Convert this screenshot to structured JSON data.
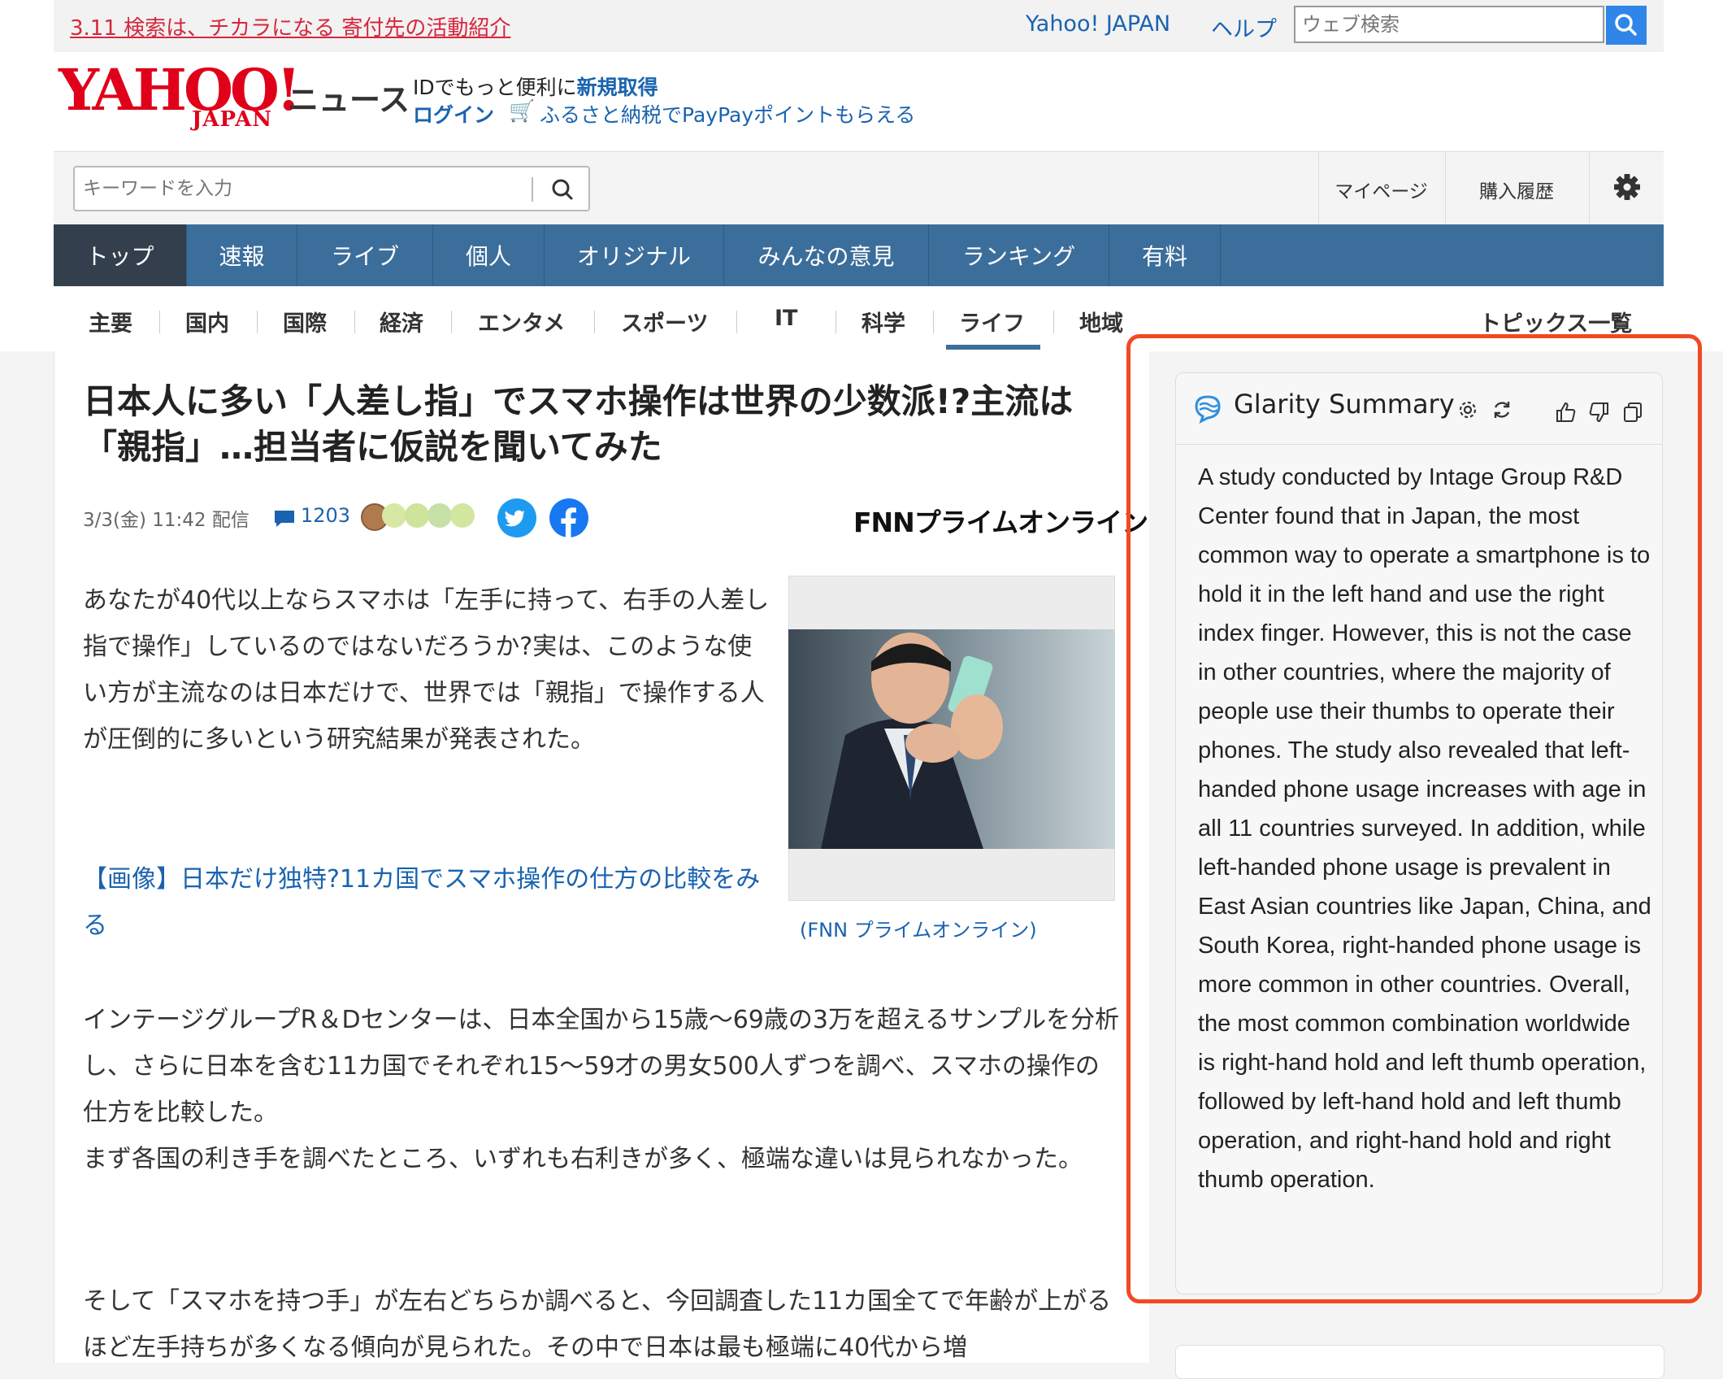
{
  "topbar": {
    "charity_link": "3.11 検索は、チカラになる 寄付先の活動紹介",
    "yahoo_japan_link": "Yahoo! JAPAN",
    "help_link": "ヘルプ",
    "web_search_placeholder": "ウェブ検索"
  },
  "header": {
    "logo_main": "YAHOO!",
    "logo_sub": "JAPAN",
    "service_name": "ニュース",
    "promo_text": "IDでもっと便利に",
    "promo_signup": "新規取得",
    "login": "ログイン",
    "furusato_link": "ふるさと納税でPayPayポイントもらえる"
  },
  "search": {
    "keyword_placeholder": "キーワードを入力",
    "mypage": "マイページ",
    "purchase_history": "購入履歴"
  },
  "main_nav": [
    "トップ",
    "速報",
    "ライブ",
    "個人",
    "オリジナル",
    "みんなの意見",
    "ランキング",
    "有料"
  ],
  "sub_nav": [
    "主要",
    "国内",
    "国際",
    "経済",
    "エンタメ",
    "スポーツ",
    "IT",
    "科学",
    "ライフ",
    "地域"
  ],
  "sub_nav_active": "ライフ",
  "topics_all": "トピックス一覧",
  "article": {
    "headline": "日本人に多い「人差し指」でスマホ操作は世界の少数派!?主流は「親指」…担当者に仮説を聞いてみた",
    "date": "3/3(金) 11:42 配信",
    "comment_count": "1203",
    "publisher_logo": "FNNプライムオンライン",
    "lead": "あなたが40代以上ならスマホは「左手に持って、右手の人差し指で操作」しているのではないだろうか?実は、このような使い方が主流なのは日本だけで、世界では「親指」で操作する人が圧倒的に多いという研究結果が発表された。",
    "image_link": "【画像】日本だけ独特?11カ国でスマホ操作の仕方の比較をみる",
    "image_caption": "(FNN プライムオンライン)",
    "para2": "インテージグループR＆Dセンターは、日本全国から15歳〜69歳の3万を超えるサンプルを分析し、さらに日本を含む11カ国でそれぞれ15〜59才の男女500人ずつを調べ、スマホの操作の仕方を比較した。",
    "para3": "まず各国の利き手を調べたところ、いずれも右利きが多く、極端な違いは見られなかった。",
    "para4": "そして「スマホを持つ手」が左右どちらか調べると、今回調査した11カ国全てで年齢が上がるほど左手持ちが多くなる傾向が見られた。その中で日本は最も極端に40代から増"
  },
  "glarity": {
    "title": "Glarity Summary",
    "summary": "A study conducted by Intage Group R&D Center found that in Japan, the most common way to operate a smartphone is to hold it in the left hand and use the right index finger. However, this is not the case in other countries, where the majority of people use their thumbs to operate their phones. The study also revealed that left-handed phone usage increases with age in all 11 countries surveyed. In addition, while left-handed phone usage is prevalent in East Asian countries like Japan, China, and South Korea, right-handed phone usage is more common in other countries. Overall, the most common combination worldwide is right-hand hold and left thumb operation, followed by left-hand hold and left thumb operation, and right-hand hold and right thumb operation."
  },
  "colors": {
    "nav_blue": "#3c6e9b",
    "nav_active": "#333f4d",
    "link_blue": "#1a63b0",
    "highlight_red": "#f04a23",
    "yahoo_red": "#e0001a"
  }
}
